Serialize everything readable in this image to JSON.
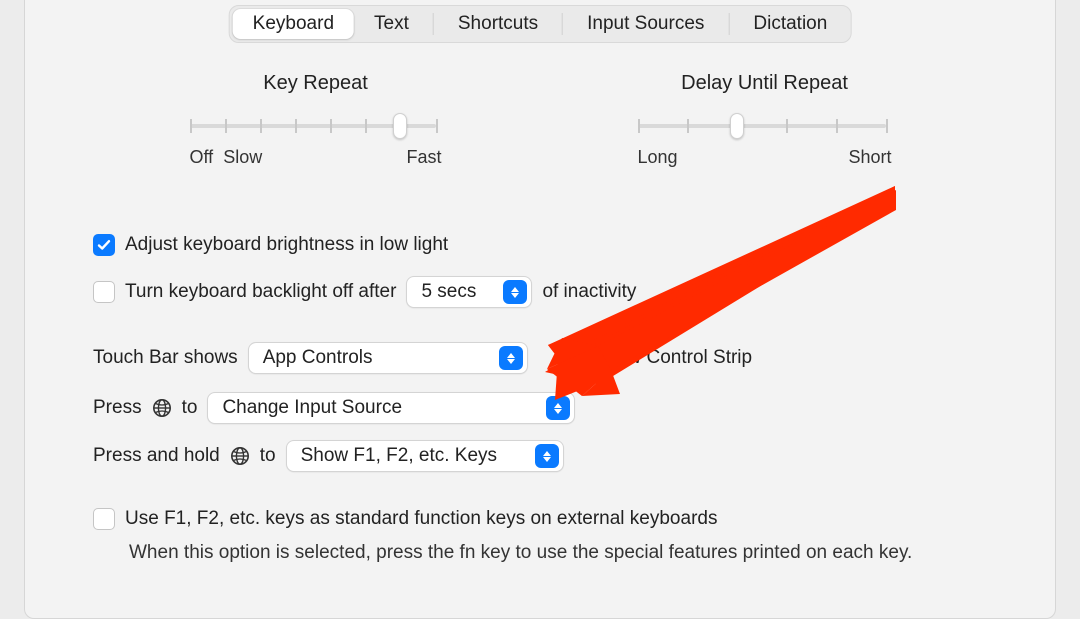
{
  "tabs": {
    "keyboard": "Keyboard",
    "text": "Text",
    "shortcuts": "Shortcuts",
    "input_sources": "Input Sources",
    "dictation": "Dictation"
  },
  "sliders": {
    "key_repeat": {
      "title": "Key Repeat",
      "left1": "Off",
      "left2": "Slow",
      "right": "Fast"
    },
    "delay_repeat": {
      "title": "Delay Until Repeat",
      "left": "Long",
      "right": "Short"
    }
  },
  "rows": {
    "adjust_brightness": "Adjust keyboard brightness in low light",
    "backlight_off_prefix": "Turn keyboard backlight off after",
    "backlight_off_value": "5 secs",
    "backlight_off_suffix": "of inactivity",
    "touchbar_label": "Touch Bar shows",
    "touchbar_value": "App Controls",
    "show_control_strip": "Show Control Strip",
    "press_globe_prefix": "Press",
    "press_globe_mid": "to",
    "press_globe_value": "Change Input Source",
    "press_hold_globe_prefix": "Press and hold",
    "press_hold_globe_mid": "to",
    "press_hold_globe_value": "Show F1, F2, etc. Keys",
    "fn_keys_label": "Use F1, F2, etc. keys as standard function keys on external keyboards",
    "fn_keys_help": "When this option is selected, press the fn key to use the special features printed on each key."
  }
}
